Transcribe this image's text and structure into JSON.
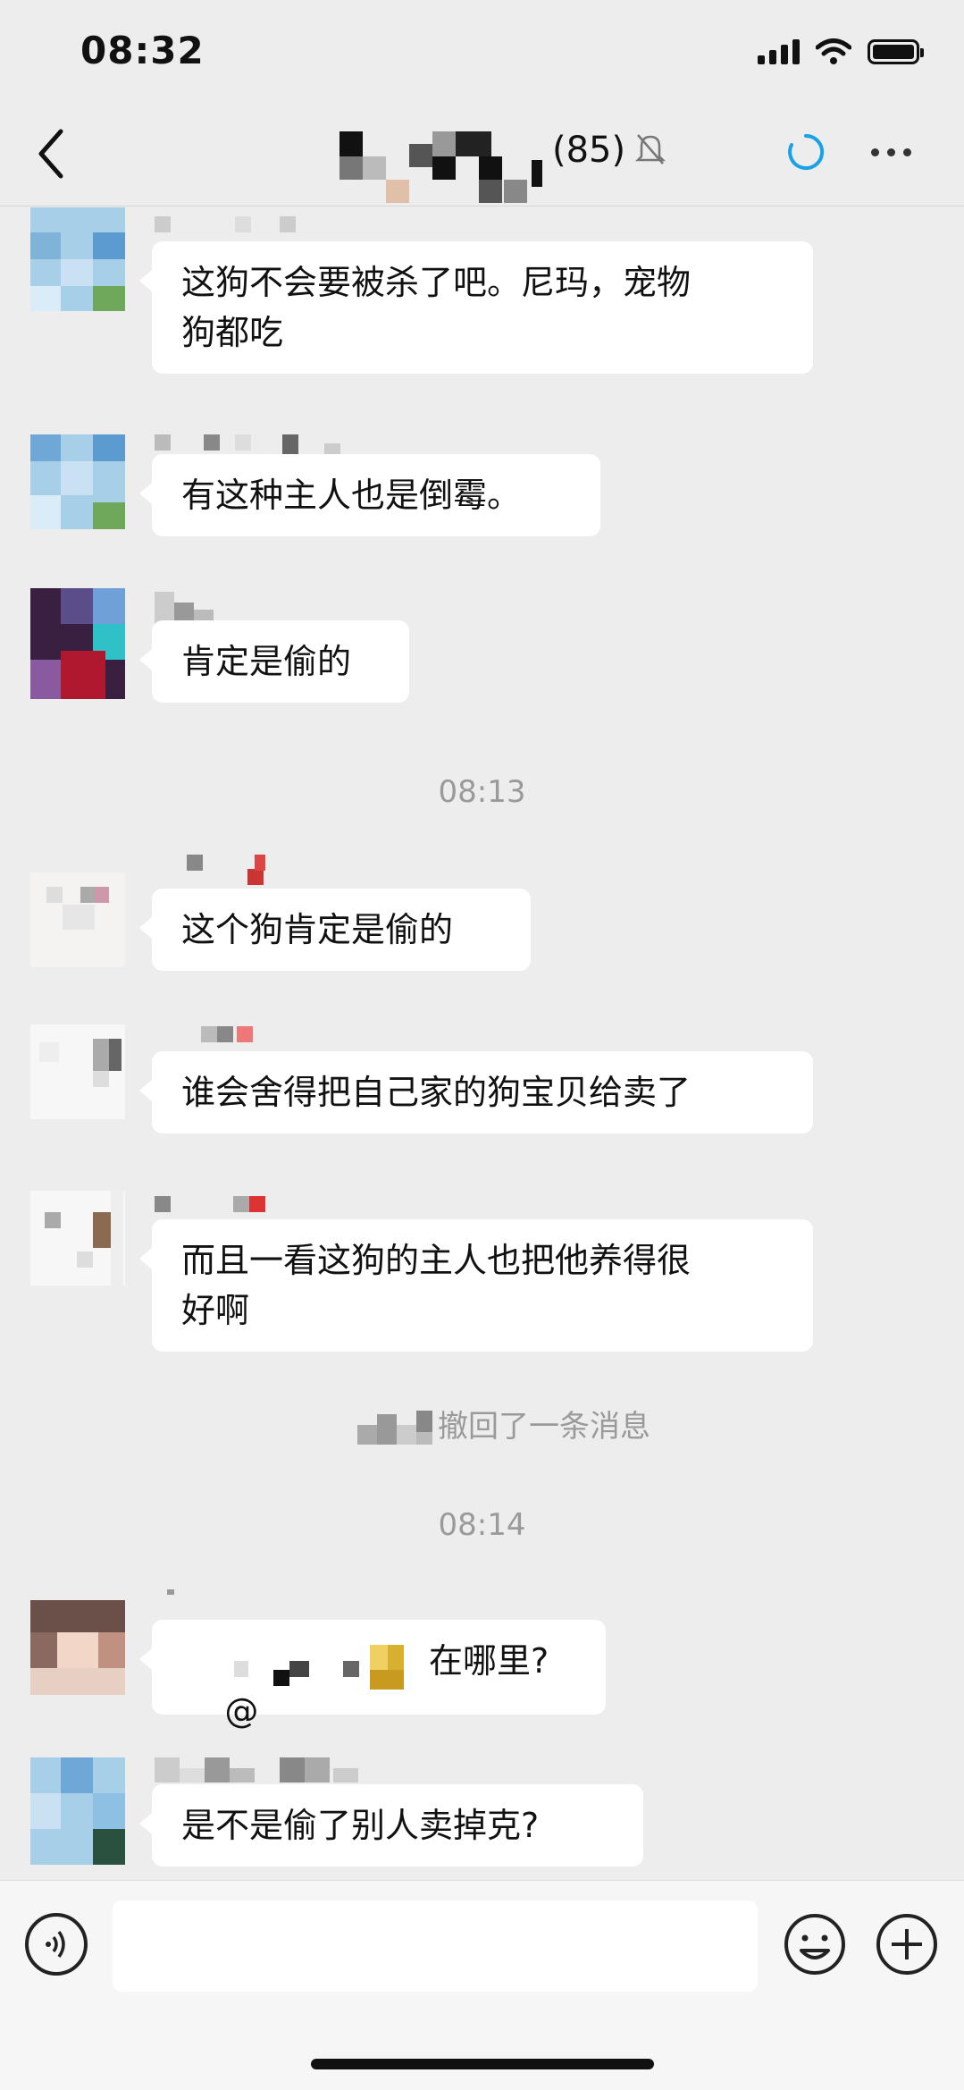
{
  "status_bar": {
    "time": "08:32"
  },
  "nav": {
    "member_count": "(85)"
  },
  "timestamps": [
    "08:13",
    "08:14"
  ],
  "system_message": "撤回了一条消息",
  "messages": [
    {
      "text": "这狗不会要被杀了吧。尼玛，宠物\n狗都吃"
    },
    {
      "text": "有这种主人也是倒霉。"
    },
    {
      "text": "肯定是偷的"
    },
    {
      "text": "这个狗肯定是偷的"
    },
    {
      "text": "谁会舍得把自己家的狗宝贝给卖了"
    },
    {
      "text": "而且一看这狗的主人也把他养得很\n好啊"
    },
    {
      "text_prefix": "@",
      "text_suffix": "在哪里?"
    },
    {
      "text": "是不是偷了别人卖掉克?"
    }
  ],
  "input": {
    "placeholder": ""
  },
  "colors": {
    "background": "#ededed",
    "bubble": "#ffffff",
    "accent": "#1aa1e6"
  }
}
